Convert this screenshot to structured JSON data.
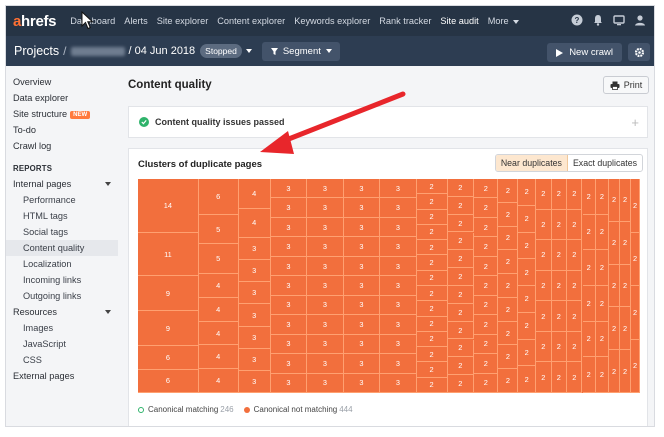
{
  "nav": {
    "logo_a": "a",
    "logo_rest": "hrefs",
    "items": [
      "Dashboard",
      "Alerts",
      "Site explorer",
      "Content explorer",
      "Keywords explorer",
      "Rank tracker",
      "Site audit",
      "More"
    ],
    "active": "Site audit",
    "icons": [
      "help-icon",
      "bell-icon",
      "monitor-icon",
      "user-icon"
    ]
  },
  "subheader": {
    "projects": "Projects",
    "sep": "/",
    "date": "/ 04 Jun 2018",
    "status": "Stopped",
    "segment": "Segment",
    "new_crawl": "New crawl"
  },
  "sidebar": {
    "items": [
      {
        "label": "Overview"
      },
      {
        "label": "Data explorer"
      },
      {
        "label": "Site structure",
        "badge": "NEW"
      },
      {
        "label": "To-do"
      },
      {
        "label": "Crawl log"
      }
    ],
    "reports_heading": "REPORTS",
    "internal_pages": "Internal pages",
    "internal_sub": [
      "Performance",
      "HTML tags",
      "Social tags",
      "Content quality",
      "Localization",
      "Incoming links",
      "Outgoing links"
    ],
    "resources": "Resources",
    "resources_sub": [
      "Images",
      "JavaScript",
      "CSS"
    ],
    "external": "External pages",
    "active_item": "Content quality"
  },
  "main": {
    "title": "Content quality",
    "print": "Print",
    "pass_text": "Content quality issues passed",
    "clusters_title": "Clusters of duplicate pages",
    "toggle": [
      "Near duplicates",
      "Exact duplicates"
    ],
    "legend": [
      {
        "label": "Canonical matching",
        "count": "246"
      },
      {
        "label": "Canonical not matching",
        "count": "444"
      }
    ]
  },
  "colors": {
    "accent": "#f26f3d",
    "nav_bg": "#263445",
    "subhead_bg": "#2d3d52",
    "success": "#2fb36b",
    "arrow": "#e8262b"
  },
  "chart_data": {
    "type": "treemap",
    "title": "Clusters of duplicate pages",
    "columns": [
      {
        "values": [
          14,
          11,
          9,
          9,
          6,
          6
        ]
      },
      {
        "values": [
          6,
          5,
          5,
          4,
          4,
          4,
          4,
          4
        ]
      },
      {
        "values": [
          4,
          4,
          3,
          3,
          3,
          3,
          3,
          3,
          3
        ]
      },
      {
        "values": [
          3,
          3,
          3,
          3,
          3,
          3,
          3,
          3,
          3,
          3,
          3
        ]
      },
      {
        "values": [
          3,
          3,
          3,
          3,
          3,
          3,
          3,
          3,
          3,
          3,
          3
        ]
      },
      {
        "values": [
          3,
          3,
          3,
          3,
          3,
          3,
          3,
          3,
          3,
          3,
          3
        ]
      },
      {
        "values": [
          3,
          3,
          3,
          3,
          3,
          3,
          3,
          3,
          3,
          3,
          3
        ]
      },
      {
        "values": [
          2,
          2,
          2,
          2,
          2,
          2,
          2,
          2,
          2,
          2,
          2,
          2,
          2,
          2
        ]
      },
      {
        "values": [
          2,
          2,
          2,
          2,
          2,
          2,
          2,
          2,
          2,
          2,
          2,
          2
        ]
      },
      {
        "values": [
          2,
          2,
          2,
          2,
          2,
          2,
          2,
          2,
          2,
          2,
          2
        ]
      },
      {
        "values": [
          2,
          2,
          2,
          2,
          2,
          2,
          2,
          2,
          2
        ]
      },
      {
        "values": [
          2,
          2,
          2,
          2,
          2,
          2,
          2,
          2
        ]
      },
      {
        "values": [
          2,
          2,
          2,
          2,
          2,
          2,
          2
        ]
      },
      {
        "values": [
          2,
          2,
          2,
          2,
          2,
          2,
          2
        ]
      },
      {
        "values": [
          2,
          2,
          2,
          2,
          2,
          2,
          2
        ]
      },
      {
        "values": [
          2,
          2,
          2,
          2,
          2,
          2
        ]
      },
      {
        "values": [
          2,
          2,
          2,
          2,
          2,
          2
        ]
      },
      {
        "values": [
          2,
          2,
          2,
          2,
          2
        ]
      },
      {
        "values": [
          2,
          2,
          2,
          2,
          2
        ]
      },
      {
        "values": [
          2,
          2,
          2,
          2
        ]
      }
    ]
  }
}
